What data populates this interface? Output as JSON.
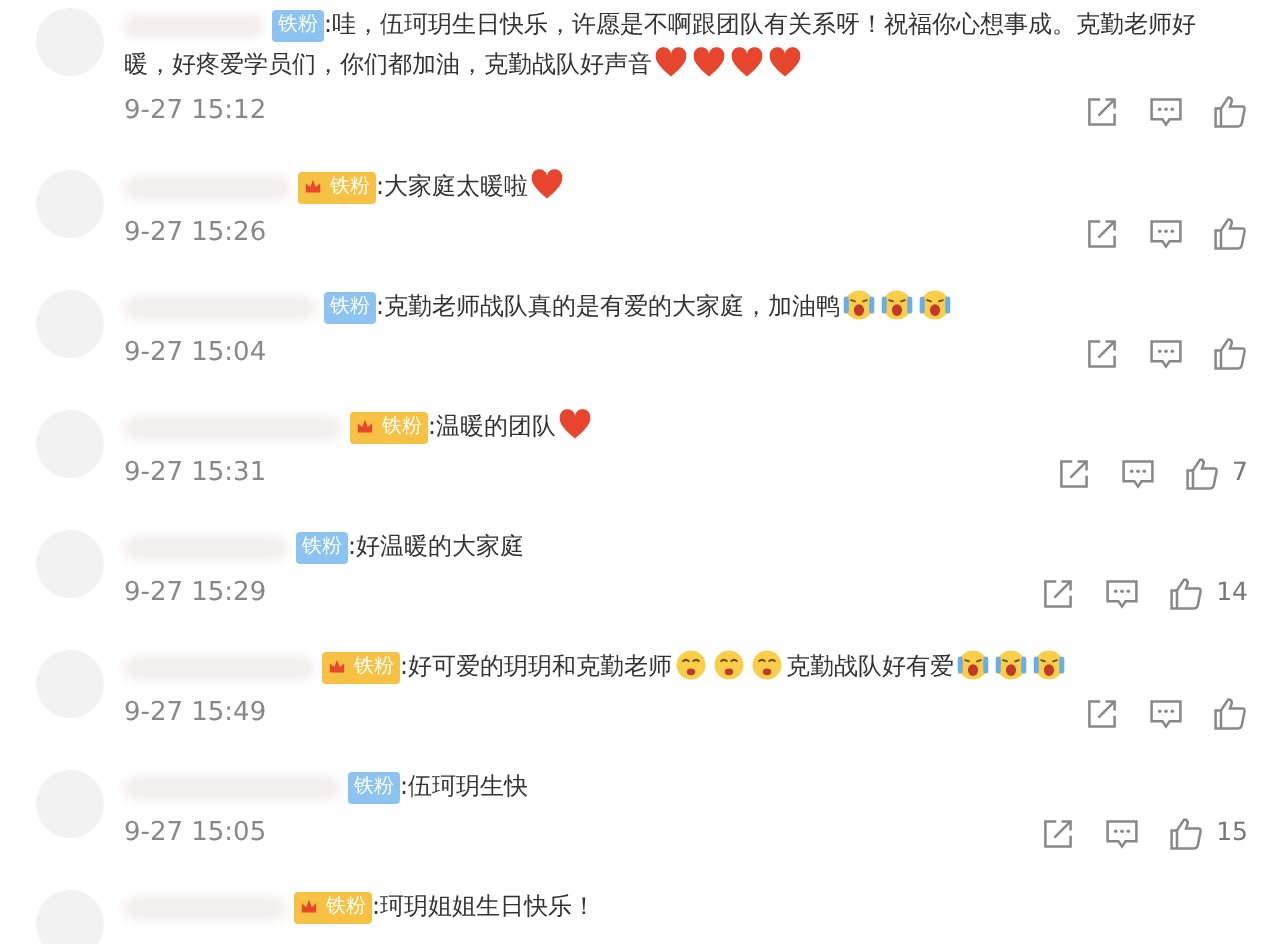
{
  "comments": [
    {
      "badge": {
        "kind": "plain",
        "text": "铁粉"
      },
      "content": [
        {
          "kind": "text",
          "text": ":哇，伍珂玥生日快乐，许愿是不啊跟团队有关系呀！祝福你心想事成。克勤老师好"
        },
        {
          "kind": "text",
          "text": "暖，好疼爱学员们，你们都加油，克勤战队好声音",
          "new_line": true
        },
        {
          "kind": "heart"
        },
        {
          "kind": "heart"
        },
        {
          "kind": "heart"
        },
        {
          "kind": "heart"
        }
      ],
      "time": "9-27 15:12"
    },
    {
      "badge": {
        "kind": "crown",
        "text": "铁粉"
      },
      "content": [
        {
          "kind": "text",
          "text": ":大家庭太暖啦"
        },
        {
          "kind": "heart"
        }
      ],
      "time": "9-27 15:26"
    },
    {
      "badge": {
        "kind": "plain",
        "text": "铁粉"
      },
      "content": [
        {
          "kind": "text",
          "text": ":克勤老师战队真的是有爱的大家庭，加油鸭"
        },
        {
          "kind": "crying"
        },
        {
          "kind": "crying"
        },
        {
          "kind": "crying"
        }
      ],
      "time": "9-27 15:04"
    },
    {
      "badge": {
        "kind": "crown",
        "text": "铁粉"
      },
      "content": [
        {
          "kind": "text",
          "text": ":温暖的团队"
        },
        {
          "kind": "heart"
        }
      ],
      "time": "9-27 15:31",
      "likes": "7"
    },
    {
      "badge": {
        "kind": "plain",
        "text": "铁粉"
      },
      "content": [
        {
          "kind": "text",
          "text": ":好温暖的大家庭"
        }
      ],
      "time": "9-27 15:29",
      "likes": "14"
    },
    {
      "badge": {
        "kind": "crown",
        "text": "铁粉"
      },
      "content": [
        {
          "kind": "text",
          "text": ":好可爱的玥玥和克勤老师"
        },
        {
          "kind": "moved"
        },
        {
          "kind": "moved"
        },
        {
          "kind": "moved"
        },
        {
          "kind": "text",
          "text": "克勤战队好有爱"
        },
        {
          "kind": "crying"
        },
        {
          "kind": "crying"
        },
        {
          "kind": "crying"
        }
      ],
      "time": "9-27 15:49"
    },
    {
      "badge": {
        "kind": "plain",
        "text": "铁粉"
      },
      "content": [
        {
          "kind": "text",
          "text": ":伍珂玥生快"
        }
      ],
      "time": "9-27 15:05",
      "likes": "15"
    },
    {
      "badge": {
        "kind": "crown",
        "text": "铁粉"
      },
      "content": [
        {
          "kind": "text",
          "text": ":珂玥姐姐生日快乐！"
        }
      ]
    }
  ]
}
